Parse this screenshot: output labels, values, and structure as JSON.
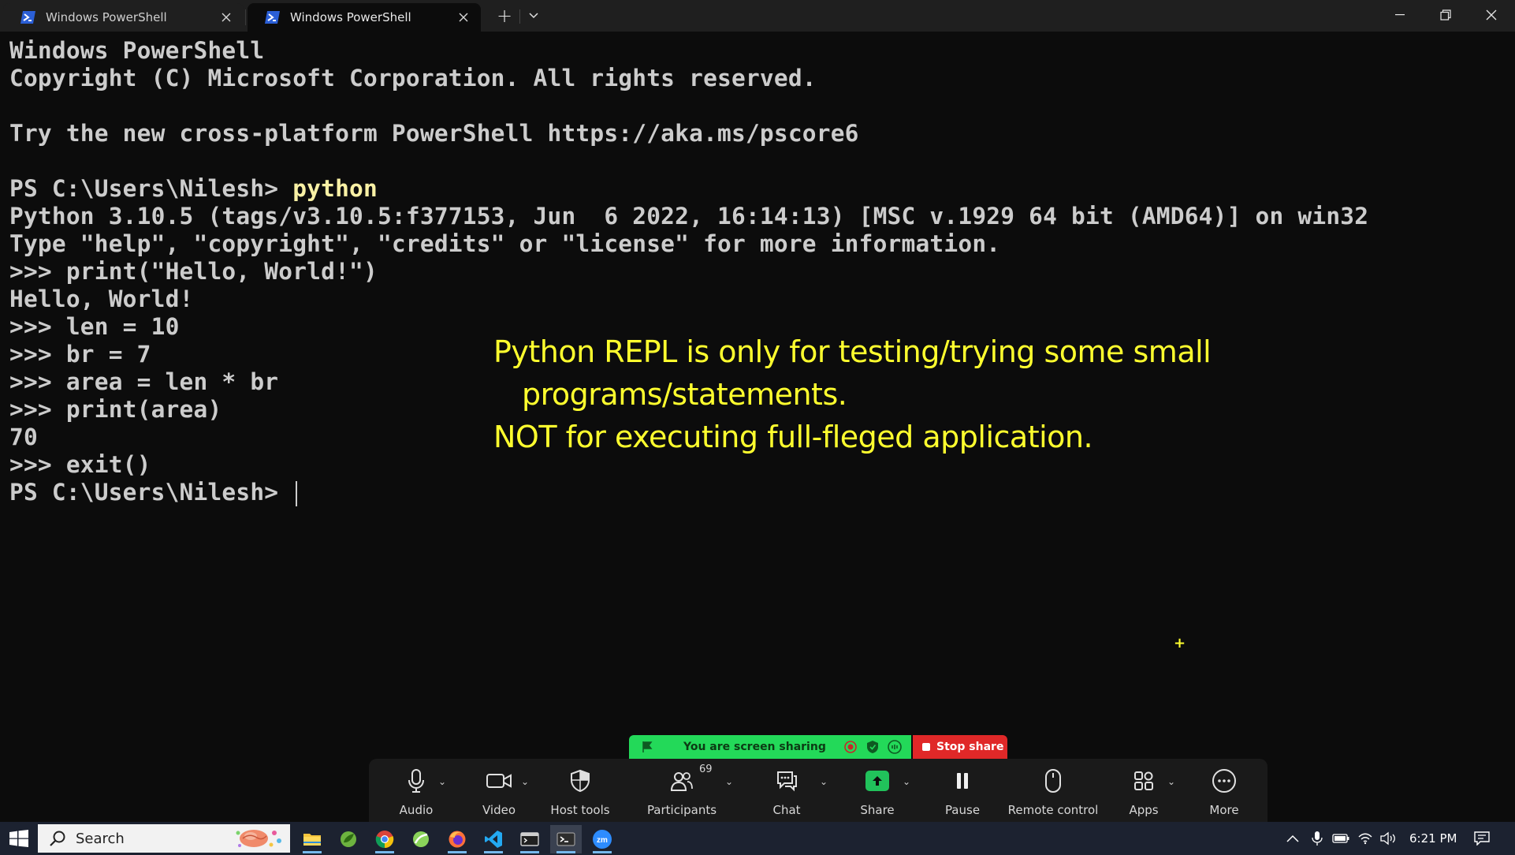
{
  "window": {
    "tabs": [
      {
        "title": "Windows PowerShell",
        "active": false
      },
      {
        "title": "Windows PowerShell",
        "active": true
      }
    ],
    "new_tab": "+"
  },
  "terminal": {
    "lines": [
      "Windows PowerShell",
      "Copyright (C) Microsoft Corporation. All rights reserved.",
      "",
      "Try the new cross-platform PowerShell https://aka.ms/pscore6",
      "",
      "PS C:\\Users\\Nilesh> ",
      "Python 3.10.5 (tags/v3.10.5:f377153, Jun  6 2022, 16:14:13) [MSC v.1929 64 bit (AMD64)] on win32",
      "Type \"help\", \"copyright\", \"credits\" or \"license\" for more information.",
      ">>> print(\"Hello, World!\")",
      "Hello, World!",
      ">>> len = 10",
      ">>> br = 7",
      ">>> area = len * br",
      ">>> print(area)",
      "70",
      ">>> exit()",
      "PS C:\\Users\\Nilesh> "
    ],
    "typed_command": "python"
  },
  "annotation": {
    "line1": "Python REPL is only for testing/trying some small",
    "line2": "programs/statements.",
    "line3": "NOT for executing full-fleged application.",
    "color": "#ffff2e"
  },
  "zoom": {
    "sharing_banner": "You are screen sharing",
    "stop_share": "Stop share",
    "toolbar": [
      {
        "label": "Audio",
        "icon": "microphone-icon"
      },
      {
        "label": "Video",
        "icon": "video-camera-icon"
      },
      {
        "label": "Host tools",
        "icon": "shield-icon"
      },
      {
        "label": "Participants",
        "icon": "participants-icon",
        "badge": "69"
      },
      {
        "label": "Chat",
        "icon": "chat-icon"
      },
      {
        "label": "Share",
        "icon": "share-arrow-icon"
      },
      {
        "label": "Pause",
        "icon": "pause-icon"
      },
      {
        "label": "Remote control",
        "icon": "mouse-icon"
      },
      {
        "label": "Apps",
        "icon": "apps-icon"
      },
      {
        "label": "More",
        "icon": "more-icon"
      }
    ]
  },
  "taskbar": {
    "search_placeholder": "Search",
    "clock": "6:21 PM",
    "apps": [
      "file-explorer-icon",
      "spring-tool-icon",
      "chrome-icon",
      "leaf-app-icon",
      "firefox-icon",
      "vscode-icon",
      "terminal-window-icon",
      "powershell-terminal-icon",
      "zoom-icon"
    ]
  },
  "colors": {
    "terminal_bg": "#0c0c0c",
    "terminal_text": "#cccccc",
    "command_highlight": "#f9f1a5",
    "zoom_green": "#23d959",
    "zoom_red": "#e02828"
  }
}
